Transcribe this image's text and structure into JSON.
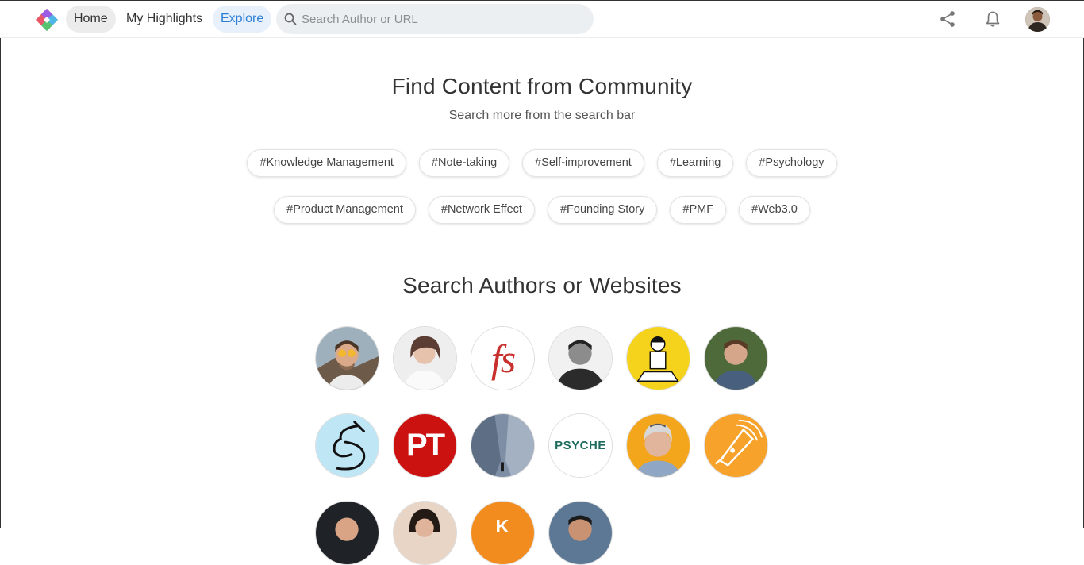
{
  "nav": {
    "home": "Home",
    "highlights": "My Highlights",
    "explore": "Explore"
  },
  "search": {
    "placeholder": "Search Author or URL"
  },
  "icons": {
    "logo": "diamond-logo",
    "search": "search-icon",
    "share": "share-icon",
    "bell": "bell-icon"
  },
  "colors": {
    "accent": "#2a7ed6",
    "explore_bg": "#e7f0fb",
    "pill_bg": "#ececec"
  },
  "community": {
    "title": "Find Content from Community",
    "subtitle": "Search more from the search bar",
    "tags_row1": [
      "#Knowledge Management",
      "#Note-taking",
      "#Self-improvement",
      "#Learning",
      "#Psychology"
    ],
    "tags_row2": [
      "#Product Management",
      "#Network Effect",
      "#Founding Story",
      "#PMF",
      "#Web3.0"
    ]
  },
  "authors": {
    "title": "Search Authors or Websites",
    "logo_fs": "fs",
    "logo_pt": "PT",
    "logo_psyche": "PSYCHE"
  }
}
